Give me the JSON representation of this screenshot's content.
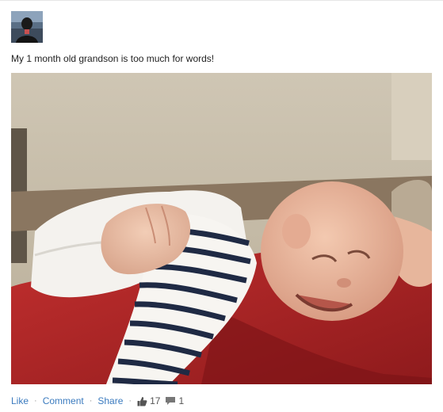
{
  "post": {
    "author_name": "",
    "caption": "My 1 month old grandson is too much for words!",
    "photo_icon": "baby-photo",
    "actions": {
      "like_label": "Like",
      "comment_label": "Comment",
      "share_label": "Share",
      "separator": "·",
      "likes_icon": "thumbs-up-icon",
      "likes_count": "17",
      "comments_icon": "comment-bubble-icon",
      "comments_count": "1"
    },
    "colors": {
      "link": "#3b7bbf",
      "text": "#222222",
      "muted": "#777777"
    }
  }
}
